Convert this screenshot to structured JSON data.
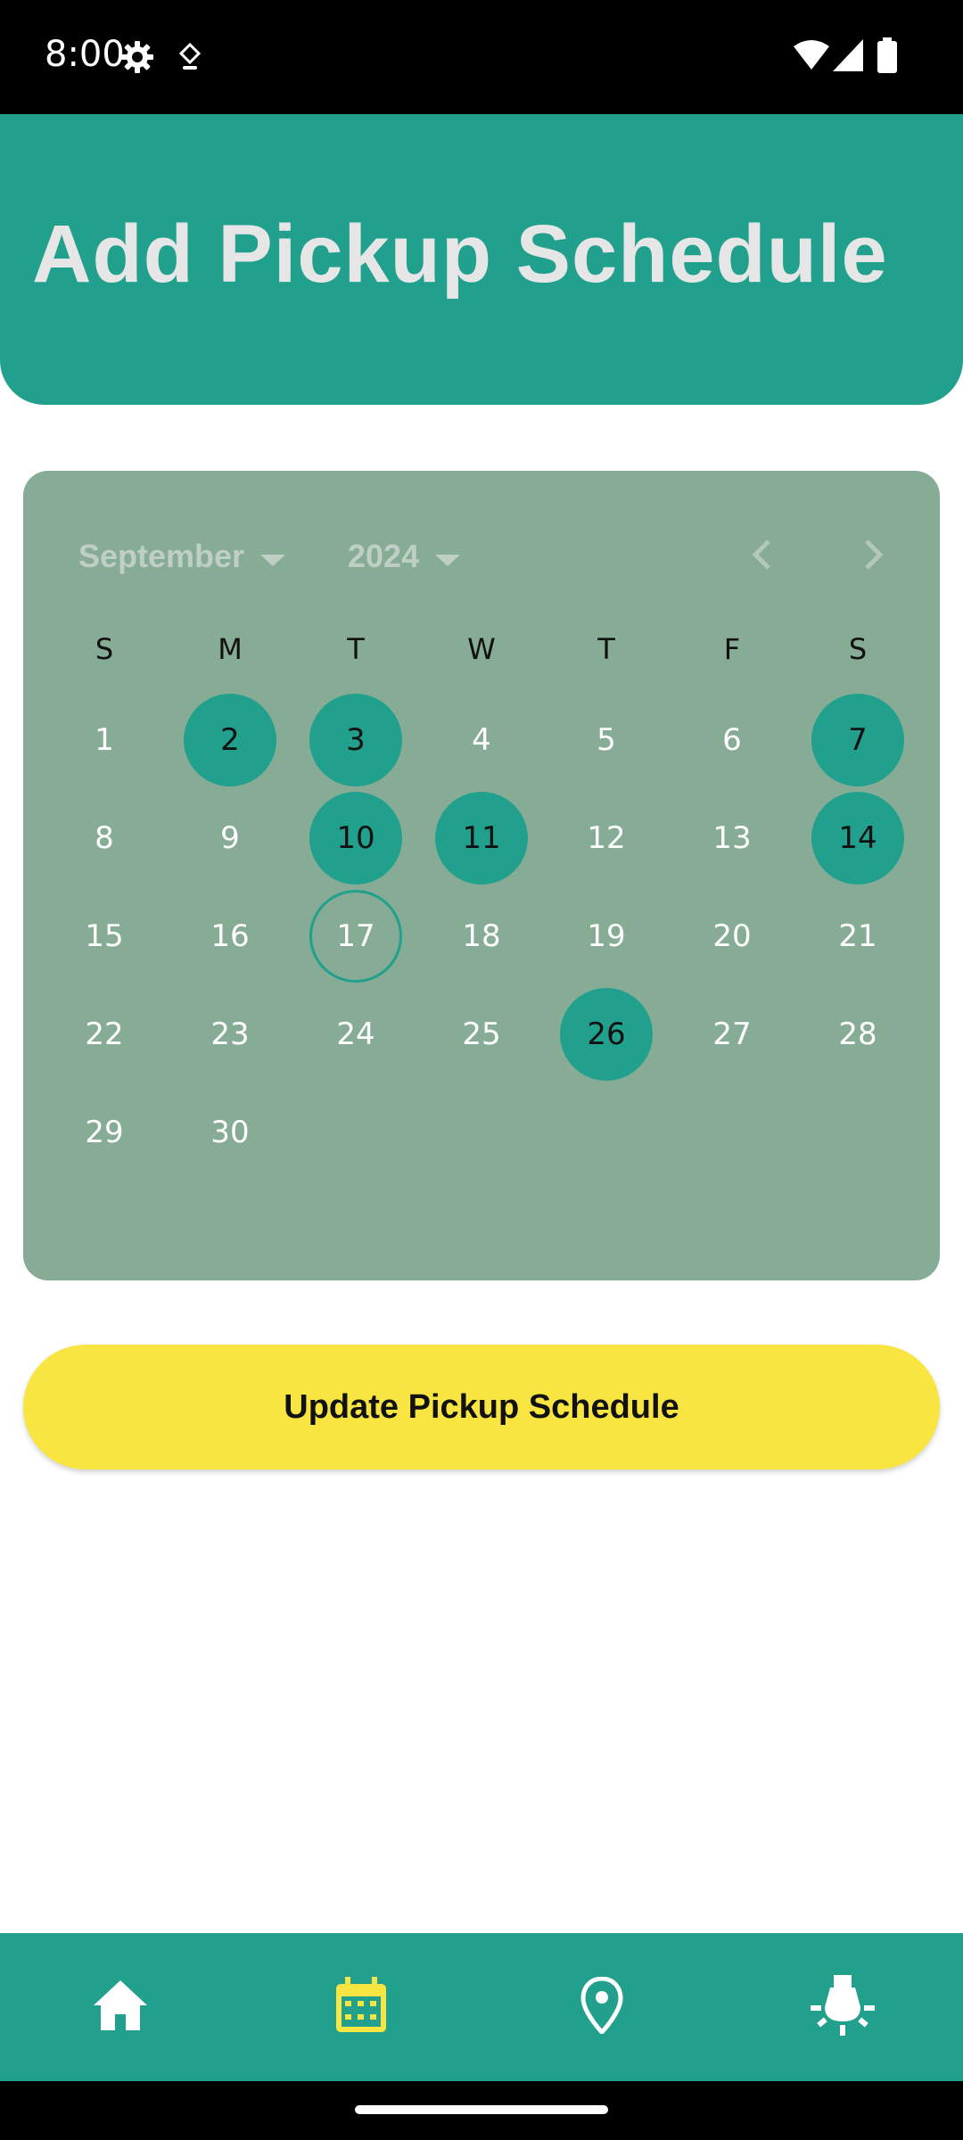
{
  "status_bar": {
    "time": "8:00",
    "left_icons": [
      "settings-gear-icon",
      "location-services-icon"
    ],
    "right_icons": [
      "wifi-icon",
      "cellular-signal-icon",
      "battery-icon"
    ]
  },
  "header": {
    "title": "Add Pickup Schedule",
    "background_color": "#20a08d"
  },
  "calendar": {
    "month_label": "September",
    "year_label": "2024",
    "weekdays": [
      "S",
      "M",
      "T",
      "W",
      "T",
      "F",
      "S"
    ],
    "days": [
      "1",
      "2",
      "3",
      "4",
      "5",
      "6",
      "7",
      "8",
      "9",
      "10",
      "11",
      "12",
      "13",
      "14",
      "15",
      "16",
      "17",
      "18",
      "19",
      "20",
      "21",
      "22",
      "23",
      "24",
      "25",
      "26",
      "27",
      "28",
      "29",
      "30"
    ],
    "first_weekday_index": 0,
    "selected_days": [
      2,
      3,
      7,
      10,
      11,
      14,
      26
    ],
    "today": 17,
    "card_color": "#86ac96",
    "selected_color": "#20a08d"
  },
  "actions": {
    "update_label": "Update Pickup Schedule",
    "button_color": "#f8e541"
  },
  "bottom_nav": {
    "items": [
      {
        "name": "home",
        "icon": "home-icon",
        "active": false
      },
      {
        "name": "schedule",
        "icon": "calendar-icon",
        "active": true
      },
      {
        "name": "location",
        "icon": "location-pin-icon",
        "active": false
      },
      {
        "name": "tips",
        "icon": "light-bulb-icon",
        "active": false
      }
    ],
    "active_color": "#f8e541",
    "inactive_color": "#ffffff"
  }
}
